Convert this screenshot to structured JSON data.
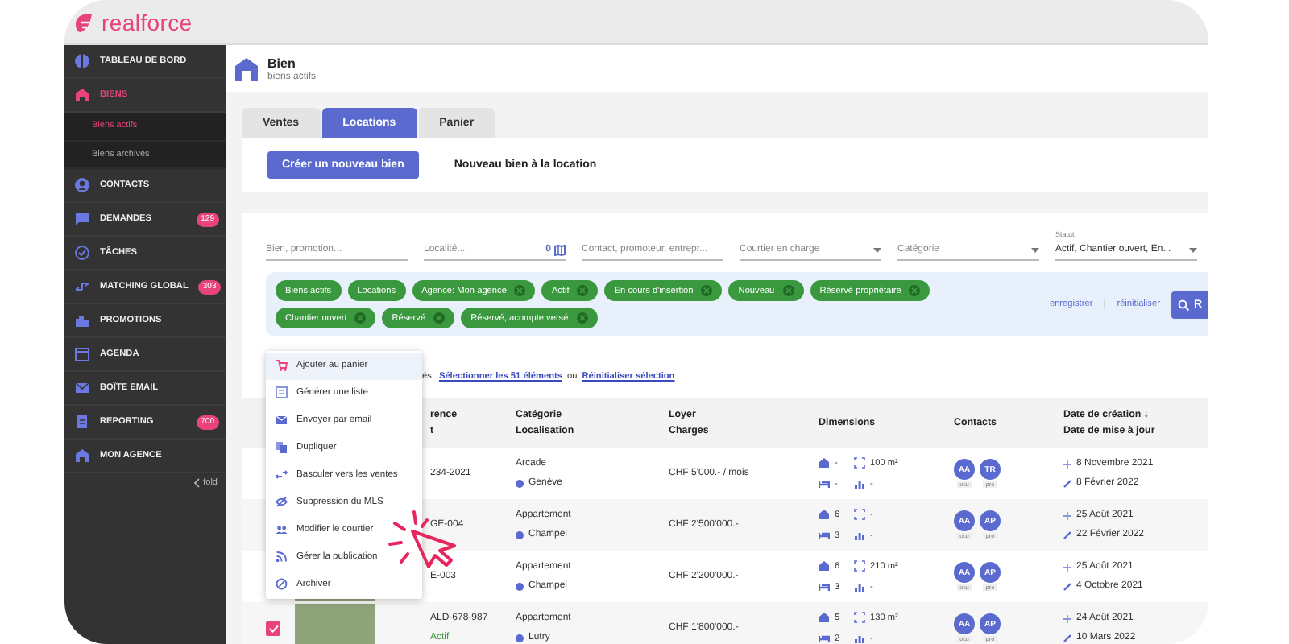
{
  "app": {
    "logo": "realforce"
  },
  "sidebar": {
    "items": [
      {
        "label": "TABLEAU DE BORD",
        "selected": false
      },
      {
        "label": "BIENS",
        "selected": true,
        "children": [
          {
            "label": "Biens actifs",
            "selected": true
          },
          {
            "label": "Biens archivés",
            "selected": false
          }
        ]
      },
      {
        "label": "CONTACTS",
        "selected": false
      },
      {
        "label": "DEMANDES",
        "selected": false,
        "badge": "129"
      },
      {
        "label": "TÂCHES",
        "selected": false
      },
      {
        "label": "MATCHING GLOBAL",
        "selected": false,
        "badge": "303"
      },
      {
        "label": "PROMOTIONS",
        "selected": false
      },
      {
        "label": "AGENDA",
        "selected": false
      },
      {
        "label": "BOÎTE EMAIL",
        "selected": false
      },
      {
        "label": "REPORTING",
        "selected": false,
        "badge": "700"
      },
      {
        "label": "MON AGENCE",
        "selected": false
      }
    ],
    "fold": "fold"
  },
  "header": {
    "title": "Bien",
    "subtitle": "biens actifs"
  },
  "tabs": [
    {
      "label": "Ventes",
      "selected": false
    },
    {
      "label": "Locations",
      "selected": true
    },
    {
      "label": "Panier",
      "selected": false
    }
  ],
  "create_button": "Créer un nouveau bien",
  "create_caption": "Nouveau bien à la location",
  "filters": [
    {
      "kind": "text",
      "placeholder": "Bien, promotion..."
    },
    {
      "kind": "map",
      "placeholder": "Localité...",
      "count": "0"
    },
    {
      "kind": "text",
      "placeholder": "Contact, promoteur, entrepr..."
    },
    {
      "kind": "select",
      "placeholder": "Courtier en charge"
    },
    {
      "kind": "select",
      "placeholder": "Catégorie"
    },
    {
      "kind": "select",
      "label": "Statut",
      "value": "Actif, Chantier ouvert, En..."
    }
  ],
  "chips": [
    {
      "label": "Biens actifs",
      "removable": false
    },
    {
      "label": "Locations",
      "removable": false
    },
    {
      "label": "Agence: Mon agence",
      "removable": true
    },
    {
      "label": "Actif",
      "removable": true
    },
    {
      "label": "En cours d'insertion",
      "removable": true
    },
    {
      "label": "Nouveau",
      "removable": true
    },
    {
      "label": "Réservé propriétaire",
      "removable": true
    },
    {
      "label": "Chantier ouvert",
      "removable": true
    },
    {
      "label": "Réservé",
      "removable": true
    },
    {
      "label": "Réservé, acompte versé",
      "removable": true
    }
  ],
  "chip_actions": [
    "enregistrer",
    "réinitialiser"
  ],
  "search_button": "R",
  "selection": {
    "prefix": "és.",
    "select_all": "Sélectionner les 51 éléments",
    "joiner": "ou",
    "reset": "Réinitialiser sélection"
  },
  "table": {
    "columns": [
      {
        "lines": [
          "rence",
          "t"
        ]
      },
      {
        "lines": [
          "Catégorie",
          "Localisation"
        ]
      },
      {
        "lines": [
          "Loyer",
          "Charges"
        ]
      },
      {
        "lines": [
          "Dimensions"
        ]
      },
      {
        "lines": [
          "Contacts"
        ]
      },
      {
        "lines": [
          "Date de création ↓",
          "Date de mise à jour"
        ]
      }
    ],
    "rows": [
      {
        "reference": "234-2021",
        "category": "Arcade",
        "location": "Genève",
        "rent": "CHF 5'000.- / mois",
        "rooms": "-",
        "area": "100 m²",
        "bedrooms": "-",
        "floor": "-",
        "contacts": [
          {
            "initials": "AA",
            "role": "ocu"
          },
          {
            "initials": "TR",
            "role": "pro"
          }
        ],
        "created": "8 Novembre 2021",
        "updated": "8 Février 2022"
      },
      {
        "reference": "GE-004",
        "category": "Appartement",
        "location": "Champel",
        "rent": "CHF 2'500'000.-",
        "rooms": "6",
        "area": "-",
        "bedrooms": "3",
        "floor": "-",
        "contacts": [
          {
            "initials": "AA",
            "role": "ocu"
          },
          {
            "initials": "AP",
            "role": "pro"
          }
        ],
        "created": "25 Août 2021",
        "updated": "22 Février 2022"
      },
      {
        "reference": "E-003",
        "category": "Appartement",
        "location": "Champel",
        "rent": "CHF 2'200'000.-",
        "rooms": "6",
        "area": "210 m²",
        "bedrooms": "3",
        "floor": "-",
        "contacts": [
          {
            "initials": "AA",
            "role": "ocu"
          },
          {
            "initials": "AP",
            "role": "pro"
          }
        ],
        "created": "25 Août 2021",
        "updated": "4 Octobre 2021"
      },
      {
        "checked": true,
        "reference": "ALD-678-987",
        "status": "Actif",
        "category": "Appartement",
        "location": "Lutry",
        "rent": "CHF 1'800'000.-",
        "rooms": "5",
        "area": "130 m²",
        "bedrooms": "2",
        "floor": "-",
        "contacts": [
          {
            "initials": "AA",
            "role": "ocu"
          },
          {
            "initials": "AP",
            "role": "pro"
          }
        ],
        "created": "24 Août 2021",
        "updated": "10 Mars 2022"
      }
    ]
  },
  "context_menu": {
    "items": [
      {
        "label": "Ajouter au panier",
        "selected": true
      },
      {
        "label": "Générer une liste",
        "selected": false
      },
      {
        "label": "Envoyer par email",
        "selected": false
      },
      {
        "label": "Dupliquer",
        "selected": false
      },
      {
        "label": "Basculer vers les ventes",
        "selected": false
      },
      {
        "label": "Suppression du MLS",
        "selected": false
      },
      {
        "label": "Modifier le courtier",
        "selected": false
      },
      {
        "label": "Gérer la publication",
        "selected": false
      },
      {
        "label": "Archiver",
        "selected": false
      }
    ]
  }
}
